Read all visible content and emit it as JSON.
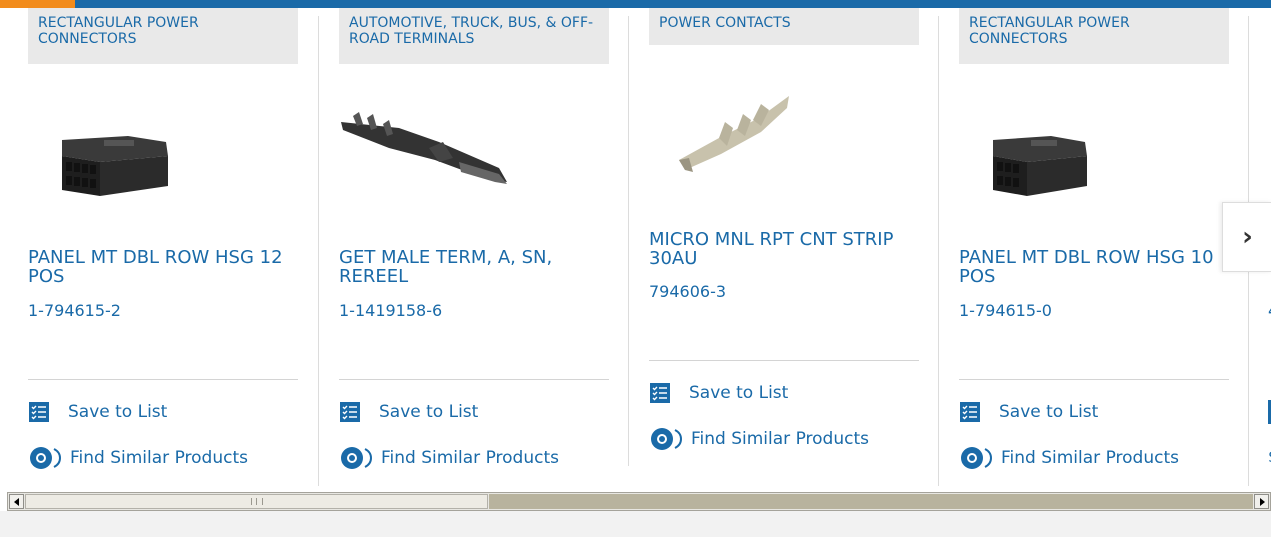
{
  "colors": {
    "brand_blue": "#1a6aa8",
    "accent_orange": "#f28c1c"
  },
  "products": [
    {
      "category": "RECTANGULAR POWER CONNECTORS",
      "name": "PANEL MT DBL ROW HSG 12 POS",
      "part_number": "1-794615-2",
      "image_icon": "black-housing-connector"
    },
    {
      "category": "AUTOMOTIVE, TRUCK, BUS, & OFF-ROAD TERMINALS",
      "name": "GET MALE TERM, A, SN, REREEL",
      "part_number": "1-1419158-6",
      "image_icon": "male-terminal"
    },
    {
      "category": "POWER CONTACTS",
      "name": "MICRO MNL RPT CNT STRIP 30AU",
      "part_number": "794606-3",
      "image_icon": "contact-strip"
    },
    {
      "category": "RECTANGULAR POWER CONNECTORS",
      "name": "PANEL MT DBL ROW HSG 10 POS",
      "part_number": "1-794615-0",
      "image_icon": "black-housing-connector"
    }
  ],
  "actions": {
    "save_label": "Save to List",
    "find_label": "Find Similar Products"
  },
  "partial_card": {
    "part_number_fragment": "4",
    "find_fragment": "$"
  },
  "carousel": {
    "next_icon": "chevron-right-icon",
    "next_glyph": "›"
  }
}
